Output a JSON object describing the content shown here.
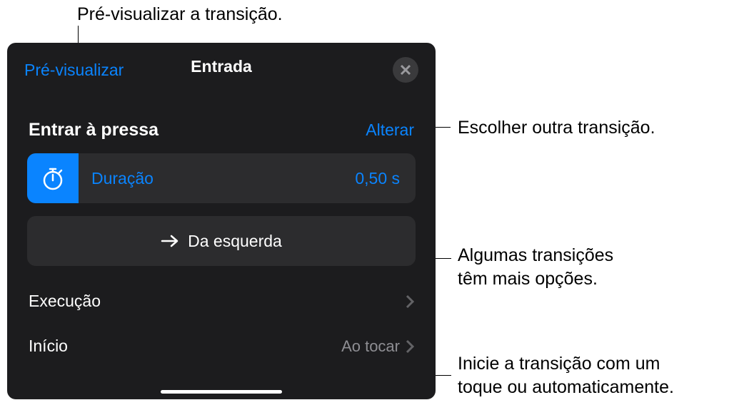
{
  "callouts": {
    "preview": "Pré-visualizar a transição.",
    "change": "Escolher outra transição.",
    "options_line1": "Algumas transições",
    "options_line2": "têm mais opções.",
    "start_line1": "Inicie a transição com um",
    "start_line2": "toque ou automaticamente."
  },
  "panel": {
    "preview_button": "Pré-visualizar",
    "title": "Entrada",
    "transition_name": "Entrar à pressa",
    "change_button": "Alterar",
    "duration_label": "Duração",
    "duration_value": "0,50 s",
    "direction_label": "Da esquerda",
    "execution_label": "Execução",
    "start_label": "Início",
    "start_value": "Ao tocar"
  }
}
